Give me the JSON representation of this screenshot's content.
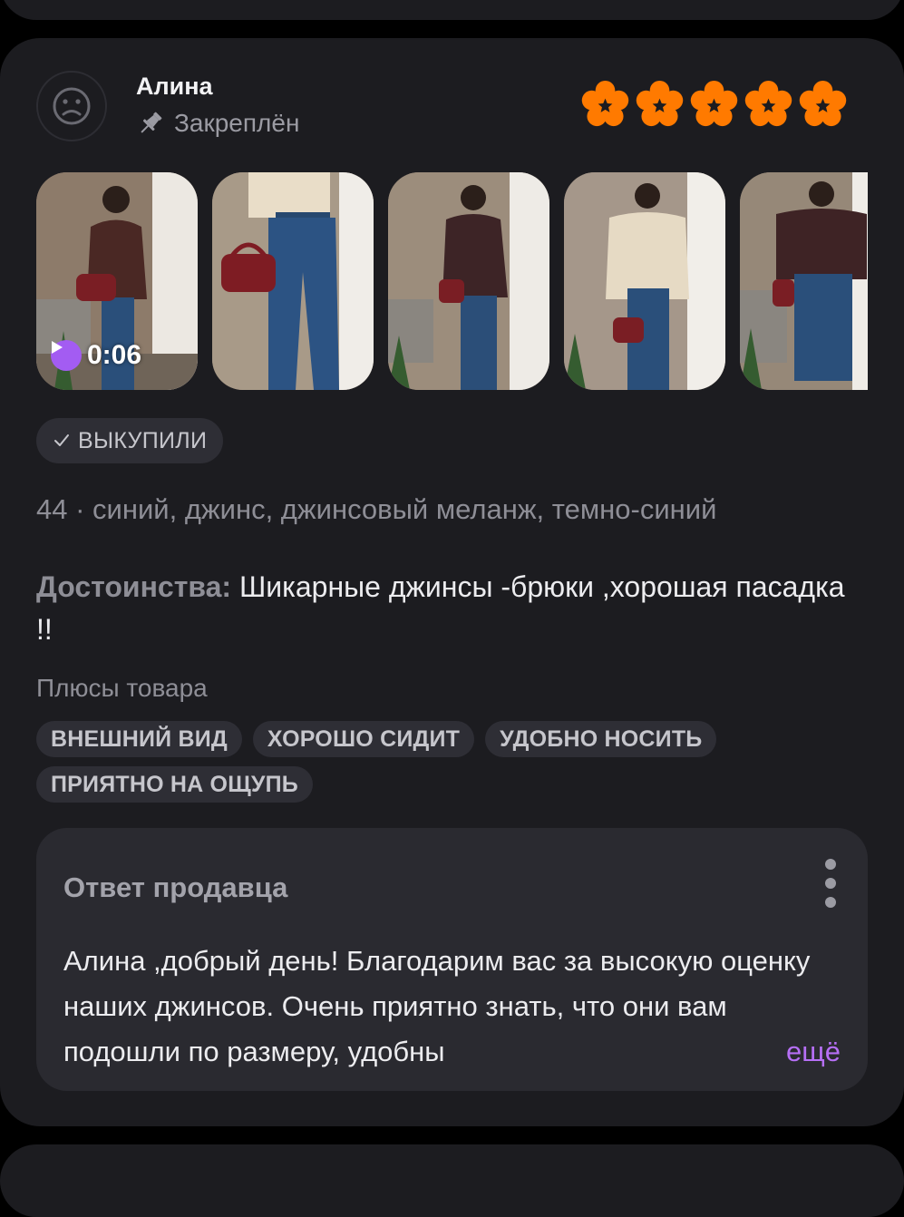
{
  "review": {
    "author": "Алина",
    "pinned_label": "Закреплён",
    "rating": 5,
    "star_color": "#ff7a00",
    "video_duration": "0:06",
    "bought_label": "ВЫКУПИЛИ",
    "variant": "44 · синий, джинс, джинсовый меланж, темно-синий",
    "advantages_label": "Достоинства:",
    "advantages_text": " Шикарные джинсы -брюки ,хорошая пасадка !!",
    "plus_label": "Плюсы товара",
    "tags": [
      "ВНЕШНИЙ ВИД",
      "ХОРОШО СИДИТ",
      "УДОБНО НОСИТЬ",
      "ПРИЯТНО НА ОЩУПЬ"
    ]
  },
  "seller_reply": {
    "title": "Ответ продавца",
    "text": "Алина ,добрый день! Благодарим вас за высокую оценку наших джинсов. Очень приятно знать, что они вам подошли по размеру, удобны",
    "more_label": "ещё",
    "accent_color": "#b66ff5"
  },
  "icons": {
    "avatar": "sad-face-icon",
    "pin": "pin-icon",
    "star": "star-icon",
    "play": "play-icon",
    "check": "check-icon",
    "more": "more-vertical-icon"
  }
}
